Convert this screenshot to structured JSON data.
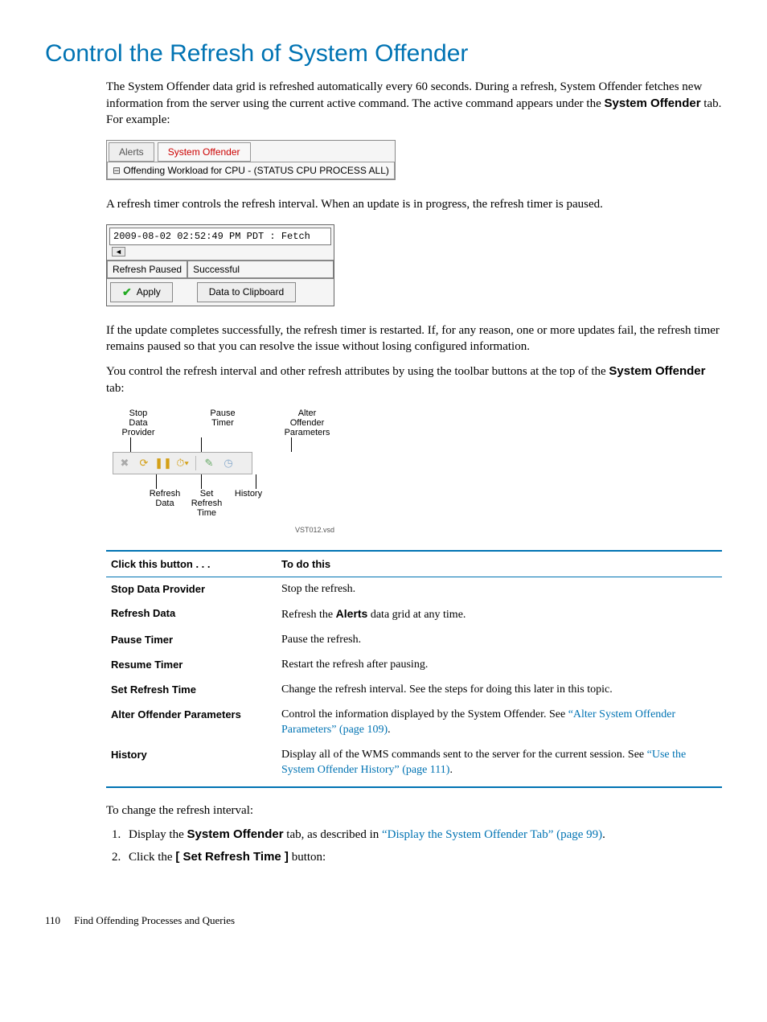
{
  "heading": "Control the Refresh of System Offender",
  "para1_pre": "The System Offender data grid is refreshed automatically every 60 seconds. During a refresh, System Offender fetches new information from the server using the current active command. The active command appears under the ",
  "para1_bold": "System Offender",
  "para1_post": " tab. For example:",
  "fig1": {
    "tab_inactive": "Alerts",
    "tab_active": "System Offender",
    "command": "Offending Workload for CPU - (STATUS CPU PROCESS ALL)"
  },
  "para2": "A refresh timer controls the refresh interval. When an update is in progress, the refresh timer is paused.",
  "fig2": {
    "timestamp": "2009-08-02 02:52:49 PM PDT : Fetch",
    "status_left": "Refresh Paused",
    "status_right": "Successful",
    "btn_apply": "Apply",
    "btn_clipboard": "Data to Clipboard"
  },
  "para3": "If the update completes successfully, the refresh timer is restarted. If, for any reason, one or more updates fail, the refresh timer remains paused so that you can resolve the issue without losing configured information.",
  "para4_pre": "You control the refresh interval and other refresh attributes by using the toolbar buttons at the top of the ",
  "para4_bold": "System Offender",
  "para4_post": " tab:",
  "fig3": {
    "lbl_stop": "Stop\nData\nProvider",
    "lbl_pause": "Pause\nTimer",
    "lbl_alter": "Alter\nOffender\nParameters",
    "lbl_refresh": "Refresh\nData",
    "lbl_set": "Set\nRefresh\nTime",
    "lbl_history": "History",
    "vsd": "VST012.vsd"
  },
  "table": {
    "head_button": "Click this button . . .",
    "head_action": "To do this",
    "rows": [
      {
        "name": "Stop Data Provider",
        "desc_pre": "Stop the refresh.",
        "bold": "",
        "desc_post": "",
        "link": "",
        "link_suffix": ""
      },
      {
        "name": "Refresh Data",
        "desc_pre": "Refresh the ",
        "bold": "Alerts",
        "desc_post": " data grid at any time.",
        "link": "",
        "link_suffix": ""
      },
      {
        "name": "Pause Timer",
        "desc_pre": "Pause the refresh.",
        "bold": "",
        "desc_post": "",
        "link": "",
        "link_suffix": ""
      },
      {
        "name": "Resume Timer",
        "desc_pre": "Restart the refresh after pausing.",
        "bold": "",
        "desc_post": "",
        "link": "",
        "link_suffix": ""
      },
      {
        "name": "Set Refresh Time",
        "desc_pre": "Change the refresh interval. See the steps for doing this later in this topic.",
        "bold": "",
        "desc_post": "",
        "link": "",
        "link_suffix": ""
      },
      {
        "name": "Alter Offender Parameters",
        "desc_pre": "Control the information displayed by the System Offender. See ",
        "bold": "",
        "desc_post": "",
        "link": "“Alter System Offender Parameters” (page 109)",
        "link_suffix": "."
      },
      {
        "name": "History",
        "desc_pre": "Display all of the WMS commands sent to the server for the current session. See ",
        "bold": "",
        "desc_post": "",
        "link": "“Use the System Offender History” (page 111)",
        "link_suffix": "."
      }
    ]
  },
  "para5": "To change the refresh interval:",
  "steps": {
    "s1_pre": "Display the ",
    "s1_bold": "System Offender",
    "s1_mid": " tab, as described in ",
    "s1_link": "“Display the System Offender Tab” (page 99)",
    "s1_post": ".",
    "s2_pre": "Click the ",
    "s2_bold": "[ Set Refresh Time ]",
    "s2_post": " button:"
  },
  "footer": {
    "page": "110",
    "chapter": "Find Offending Processes and Queries"
  }
}
